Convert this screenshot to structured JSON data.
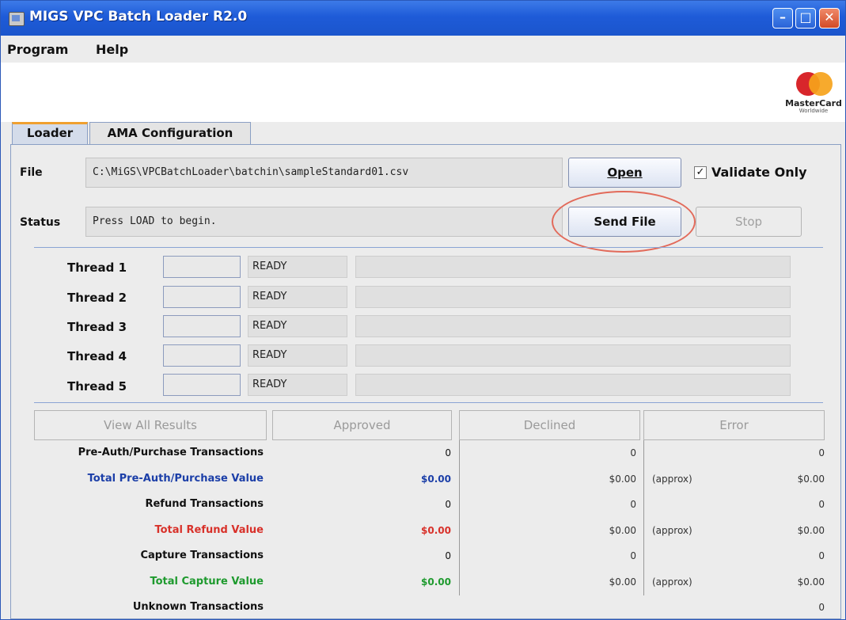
{
  "window": {
    "title": "MIGS VPC Batch Loader R2.0"
  },
  "menu": [
    "Program",
    "Help"
  ],
  "logo": {
    "name": "mastercard-logo",
    "text": "MasterCard",
    "sub": "Worldwide"
  },
  "tabs": [
    {
      "label": "Loader",
      "active": true
    },
    {
      "label": "AMA Configuration",
      "active": false
    }
  ],
  "file": {
    "label": "File",
    "value": "C:\\MiGS\\VPCBatchLoader\\batchin\\sampleStandard01.csv"
  },
  "status": {
    "label": "Status",
    "value": "Press LOAD to begin."
  },
  "buttons": {
    "open": "Open",
    "send_file": "Send File",
    "stop": "Stop"
  },
  "validate_only": {
    "label": "Validate Only",
    "checked": true
  },
  "threads": [
    {
      "label": "Thread 1",
      "status": "READY"
    },
    {
      "label": "Thread 2",
      "status": "READY"
    },
    {
      "label": "Thread 3",
      "status": "READY"
    },
    {
      "label": "Thread 4",
      "status": "READY"
    },
    {
      "label": "Thread 5",
      "status": "READY"
    }
  ],
  "results": {
    "view_all": "View All Results",
    "approved": "Approved",
    "declined": "Declined",
    "error": "Error",
    "approx_label": "(approx)",
    "rows": [
      {
        "label": "Pre-Auth/Purchase Transactions",
        "color": "#111111",
        "approved": "0",
        "declined": "0",
        "error": "0",
        "approx": false
      },
      {
        "label": "Total Pre-Auth/Purchase Value",
        "color": "#1c3fa8",
        "approved": "$0.00",
        "declined": "$0.00",
        "error": "$0.00",
        "approx": true
      },
      {
        "label": "Refund Transactions",
        "color": "#111111",
        "approved": "0",
        "declined": "0",
        "error": "0",
        "approx": false
      },
      {
        "label": "Total Refund Value",
        "color": "#d8312a",
        "approved": "$0.00",
        "declined": "$0.00",
        "error": "$0.00",
        "approx": true
      },
      {
        "label": "Capture Transactions",
        "color": "#111111",
        "approved": "0",
        "declined": "0",
        "error": "0",
        "approx": false
      },
      {
        "label": "Total Capture Value",
        "color": "#1e9a2e",
        "approved": "$0.00",
        "declined": "$0.00",
        "error": "$0.00",
        "approx": true
      },
      {
        "label": "Unknown Transactions",
        "color": "#111111",
        "approved": "",
        "declined": "",
        "error": "0",
        "approx": false
      }
    ]
  }
}
